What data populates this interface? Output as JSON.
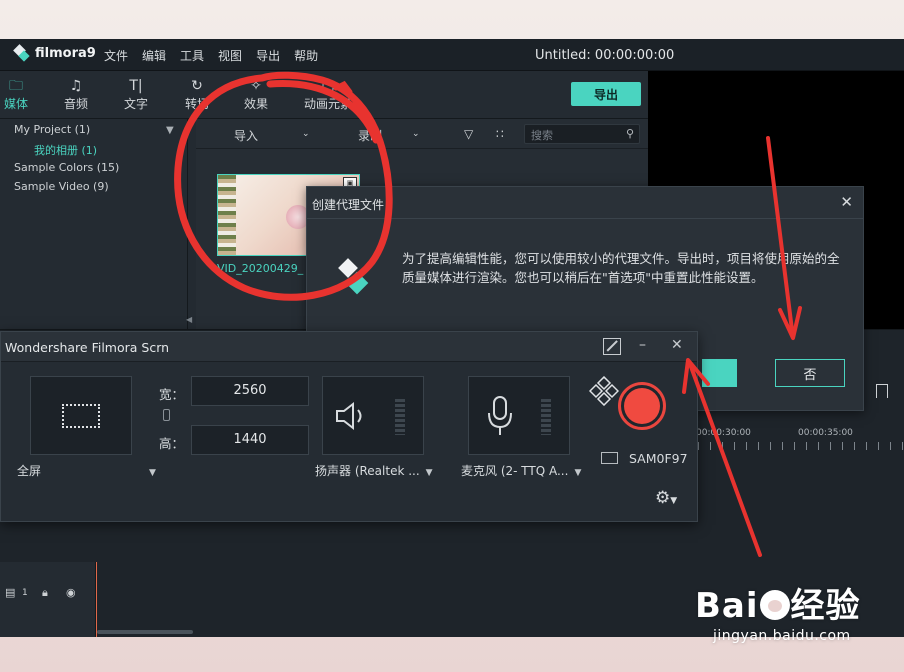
{
  "menubar": {
    "logo_text": "filmora9",
    "items": [
      "文件",
      "编辑",
      "工具",
      "视图",
      "导出",
      "帮助"
    ],
    "title": "Untitled: 00:00:00:00"
  },
  "toolbar": {
    "tools": [
      {
        "label": "媒体",
        "icon": "folder-icon"
      },
      {
        "label": "音频",
        "icon": "music-note-icon"
      },
      {
        "label": "文字",
        "icon": "text-icon"
      },
      {
        "label": "转场",
        "icon": "transition-icon"
      },
      {
        "label": "效果",
        "icon": "effects-icon"
      },
      {
        "label": "动画元素",
        "icon": "elements-icon"
      }
    ],
    "export_label": "导出"
  },
  "sidebar": {
    "items": [
      {
        "label": "My Project (1)"
      },
      {
        "label": "我的相册 (1)"
      },
      {
        "label": "Sample Colors (15)"
      },
      {
        "label": "Sample Video (9)"
      }
    ]
  },
  "media_bar": {
    "import_label": "导入",
    "record_label": "录制",
    "search_placeholder": "搜索"
  },
  "media": {
    "clip_name": "VID_20200429_"
  },
  "timeline": {
    "ruler_labels": [
      "00:00:30:00",
      "00:00:35:00"
    ],
    "track_number": "1"
  },
  "proxy_dialog": {
    "title": "创建代理文件",
    "message": "为了提高编辑性能，您可以使用较小的代理文件。导出时，项目将使用原始的全质量媒体进行渲染。您也可以稍后在\"首选项\"中重置此性能设置。",
    "no_label": "否"
  },
  "scrn": {
    "title": "Wondershare Filmora Scrn",
    "width_label": "宽：",
    "width_value": "2560",
    "height_label": "高：",
    "height_value": "1440",
    "area_mode": "全屏",
    "speaker": "扬声器 (Realtek ...",
    "microphone": "麦克风 (2- TTQ A...",
    "monitor": "SAM0F97"
  },
  "watermark": {
    "logo_a": "Bai",
    "logo_b": "经验",
    "sub": "jingyan.baidu.com"
  },
  "colors": {
    "accent": "#4ad4c0",
    "record": "#f04a40",
    "annotation": "#e8332f"
  }
}
